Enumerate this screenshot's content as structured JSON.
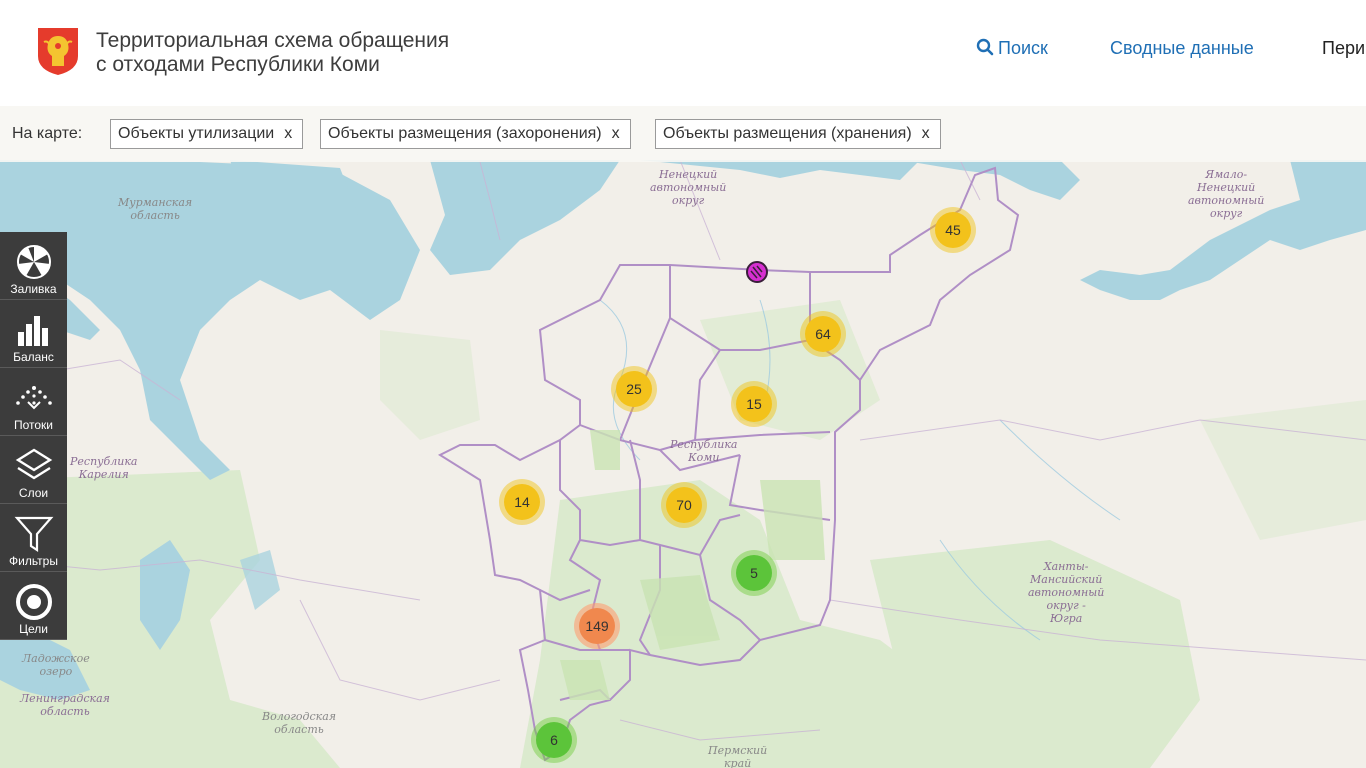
{
  "header": {
    "title_line1": "Территориальная схема обращения",
    "title_line2": "с отходами Республики Коми",
    "nav_search": "Поиск",
    "nav_summary": "Сводные данные",
    "nav_more": "Пери"
  },
  "filters": {
    "label": "На карте:",
    "chips": [
      {
        "text": "Объекты утилизации",
        "close": "x"
      },
      {
        "text": "Объекты размещения (захоронения)",
        "close": "x"
      },
      {
        "text": "Объекты размещения (хранения)",
        "close": "x"
      }
    ]
  },
  "toolbar": [
    {
      "label": "Заливка",
      "icon": "fill-icon"
    },
    {
      "label": "Баланс",
      "icon": "balance-icon"
    },
    {
      "label": "Потоки",
      "icon": "flows-icon"
    },
    {
      "label": "Слои",
      "icon": "layers-icon"
    },
    {
      "label": "Фильтры",
      "icon": "filter-icon"
    },
    {
      "label": "Цели",
      "icon": "target-icon"
    }
  ],
  "clusters": [
    {
      "count": "45",
      "color": "yellow"
    },
    {
      "count": "64",
      "color": "yellow"
    },
    {
      "count": "25",
      "color": "yellow"
    },
    {
      "count": "15",
      "color": "yellow"
    },
    {
      "count": "14",
      "color": "yellow"
    },
    {
      "count": "70",
      "color": "yellow"
    },
    {
      "count": "5",
      "color": "green"
    },
    {
      "count": "149",
      "color": "orange"
    },
    {
      "count": "6",
      "color": "green"
    }
  ],
  "map_labels": {
    "nenets": [
      "Ненецкий",
      "автономный",
      "округ"
    ],
    "murmansk": [
      "Мурманская",
      "область"
    ],
    "yamal": [
      "Ямало-",
      "Ненецкий",
      "автономный",
      "округ"
    ],
    "komi": [
      "Республика",
      "Коми"
    ],
    "karelia": [
      "Республика",
      "Карелия"
    ],
    "khanty": [
      "Ханты-",
      "Мансийский",
      "автономный",
      "округ -",
      "Югра"
    ],
    "ladoga": [
      "Ладожское",
      "озеро"
    ],
    "leningrad": [
      "Ленинградская",
      "область"
    ],
    "vologda": [
      "Вологодская",
      "область"
    ],
    "perm": [
      "Пермский",
      "край"
    ]
  },
  "colors": {
    "accent": "#1f6fb5",
    "water": "#aad3df",
    "land": "#f2efe9",
    "forest": "#d6e8c8",
    "border": "#b49cc6",
    "toolbar": "#3c3c3c"
  }
}
